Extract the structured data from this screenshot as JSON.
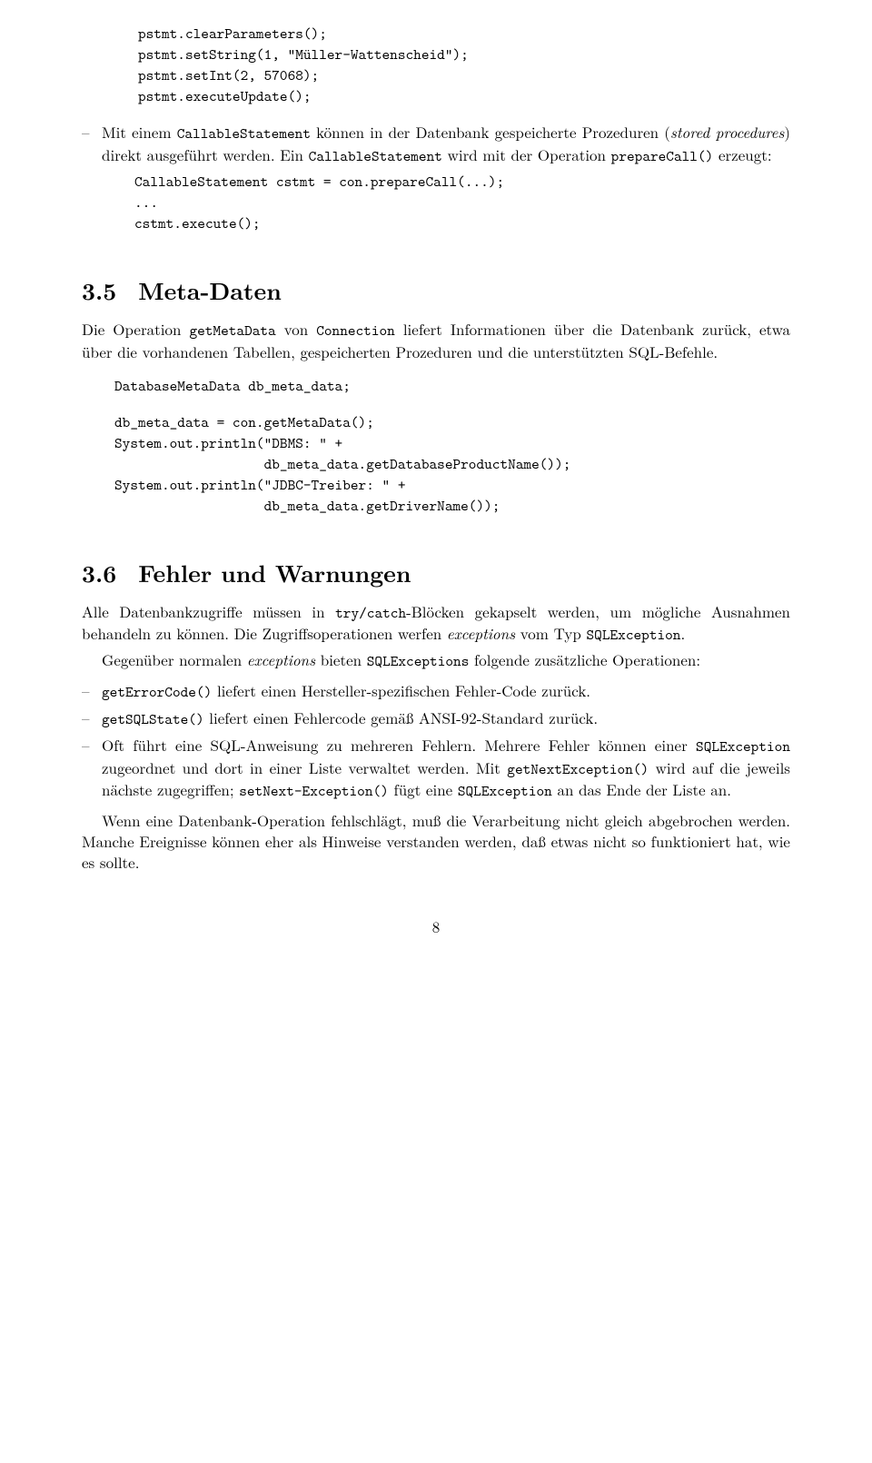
{
  "code_top": "   pstmt.clearParameters();\n   pstmt.setString(1, \"Müller-Wattenscheid\");\n   pstmt.setInt(2, 57068);\n   pstmt.executeUpdate();",
  "li_callable": {
    "pre": "Mit einem ",
    "tt1": "CallableStatement",
    "mid1": " können in der Datenbank gespeicherte Prozeduren (",
    "it1": "stored procedures",
    "mid2": ") direkt ausgeführt werden. Ein ",
    "tt2": "CallableStatement",
    "mid3": " wird mit der Operation ",
    "tt3": "prepareCall()",
    "post": " erzeugt:"
  },
  "code_callable": "CallableStatement cstmt = con.prepareCall(...);\n...\ncstmt.execute();",
  "sec35": {
    "num": "3.5",
    "title": "Meta-Daten"
  },
  "p35": {
    "pre": "Die Operation ",
    "tt1": "getMetaData",
    "mid1": " von ",
    "tt2": "Connection",
    "post": " liefert Informationen über die Datenbank zurück, etwa über die vorhandenen Tabellen, gespeicherten Prozeduren und die unterstützten SQL-Befehle."
  },
  "code35a": "DatabaseMetaData db_meta_data;",
  "code35b": "db_meta_data = con.getMetaData();\nSystem.out.println(\"DBMS: \" +\n                   db_meta_data.getDatabaseProductName());\nSystem.out.println(\"JDBC-Treiber: \" +\n                   db_meta_data.getDriverName());",
  "sec36": {
    "num": "3.6",
    "title": "Fehler und Warnungen"
  },
  "p36a": {
    "pre": "Alle Datenbankzugriffe müssen in ",
    "tt1": "try/catch",
    "mid1": "-Blöcken gekapselt werden, um mögliche Ausnahmen behandeln zu können. Die Zugriffsoperationen werfen ",
    "it1": "exceptions",
    "mid2": " vom Typ ",
    "tt2": "SQLException",
    "post": "."
  },
  "p36b": {
    "pre": "Gegenüber normalen ",
    "it1": "exceptions",
    "mid1": " bieten ",
    "tt1": "SQLExceptions",
    "post": " folgende zusätzliche Operationen:"
  },
  "li36_1": {
    "tt1": "getErrorCode()",
    "post": " liefert einen Hersteller-spezifischen Fehler-Code zurück."
  },
  "li36_2": {
    "tt1": "getSQLState()",
    "post": " liefert einen Fehlercode gemäß ANSI-92-Standard zurück."
  },
  "li36_3": {
    "pre": "Oft führt eine SQL-Anweisung zu mehreren Fehlern. Mehrere Fehler können einer ",
    "tt1": "SQLException",
    "mid1": " zugeordnet und dort in einer Liste verwaltet werden. Mit ",
    "tt2": "getNextException()",
    "mid2": " wird auf die jeweils nächste zugegriffen; ",
    "tt3": "setNext-Exception()",
    "mid3": " fügt eine ",
    "tt4": "SQLException",
    "post": " an das Ende der Liste an."
  },
  "p36c": "Wenn eine Datenbank-Operation fehlschlägt, muß die Verarbeitung nicht gleich abgebrochen werden. Manche Ereignisse können eher als Hinweise verstanden werden, daß etwas nicht so funktioniert hat, wie es sollte.",
  "page_num": "8"
}
